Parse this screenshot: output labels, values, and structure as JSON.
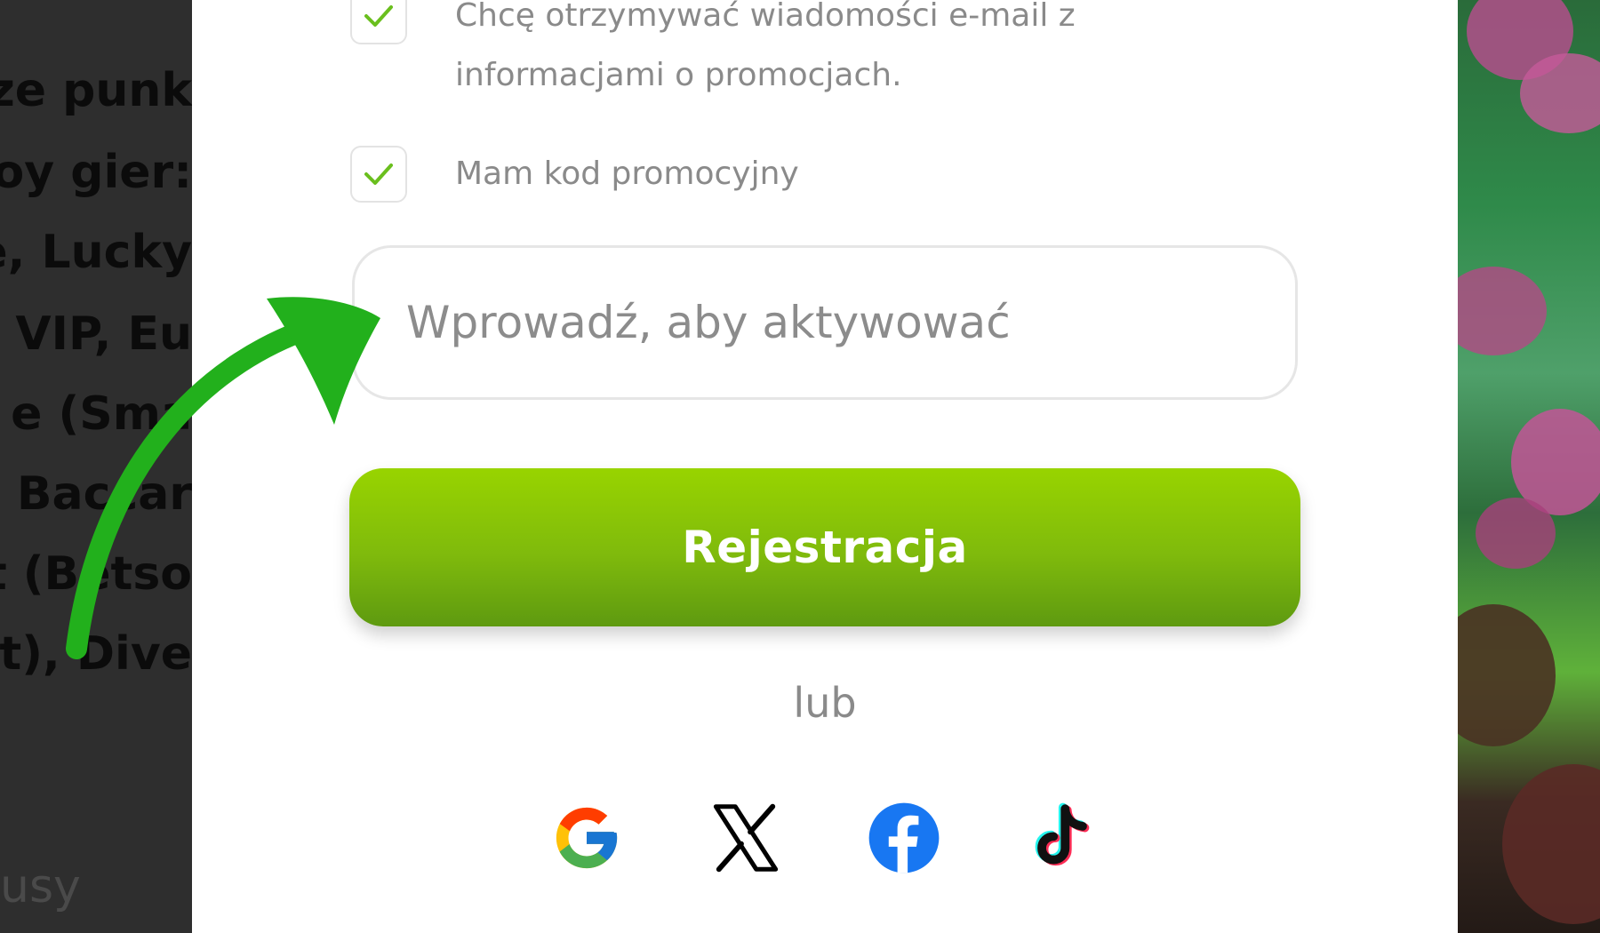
{
  "background_page": {
    "lines": [
      "ze punk",
      "oy gier:",
      "e, Lucky",
      "e VIP, Eu",
      "e (Sma",
      " Baccar",
      "t (Betso",
      "nt), Dive"
    ],
    "bonus_fragment": "usy"
  },
  "modal": {
    "checkbox_email": {
      "checked": true,
      "label_line1": "Chcę otrzymywać wiadomości e-mail z",
      "label_line2": "informacjami o promocjach."
    },
    "checkbox_promo": {
      "checked": true,
      "label": "Mam kod promocyjny"
    },
    "promo_input": {
      "value": "",
      "placeholder": "Wprowadź, aby aktywować"
    },
    "register_button": "Rejestracja",
    "or_text": "lub",
    "social_logins": [
      "google-icon",
      "x-icon",
      "facebook-icon",
      "tiktok-icon"
    ]
  },
  "colors": {
    "accent_green": "#7fba0c",
    "check_green": "#6abf1e",
    "annotation_arrow": "#22b01c",
    "overlay": "#2b2b2b"
  }
}
